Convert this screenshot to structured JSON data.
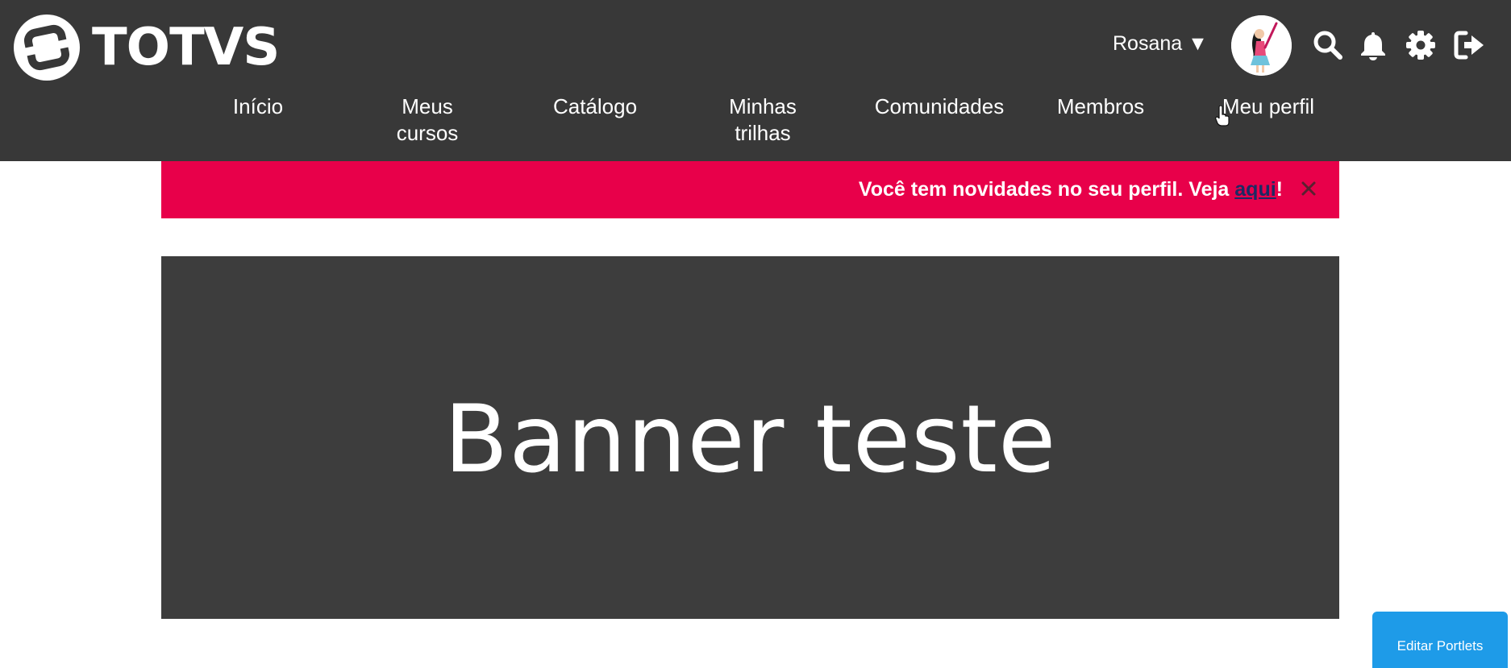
{
  "brand": {
    "logo_text": "TOTVS",
    "logo_icon": "totvs-logo-icon"
  },
  "header": {
    "user_name": "Rosana ▼",
    "avatar_icon": "user-avatar",
    "icons": [
      "search-icon",
      "bell-icon",
      "gear-icon",
      "logout-icon"
    ],
    "background_color": "#383838"
  },
  "nav": {
    "items": [
      {
        "label": "Início"
      },
      {
        "label": "Meus cursos"
      },
      {
        "label": "Catálogo"
      },
      {
        "label": "Minhas trilhas"
      },
      {
        "label": "Comunidades"
      },
      {
        "label": "Membros"
      },
      {
        "label": "Meu perfil"
      }
    ]
  },
  "notice": {
    "text": "Você tem novidades no seu perfil. Veja ",
    "link_text": "aqui",
    "suffix": "!",
    "close_icon": "close-icon",
    "background_color": "#e8004a"
  },
  "banner": {
    "title": "Banner teste",
    "background_color": "#3d3d3d"
  },
  "edit_portlets": {
    "label": "Editar Portlets",
    "background_color": "#1e9be8"
  }
}
